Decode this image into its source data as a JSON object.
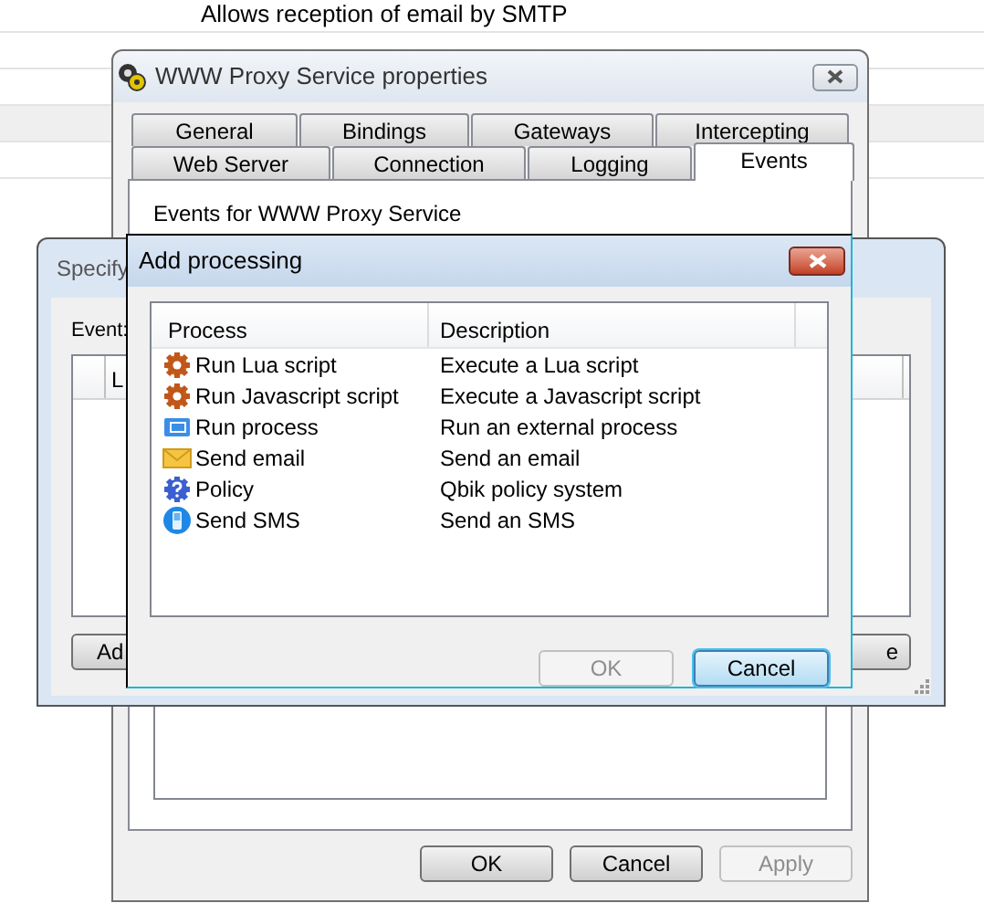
{
  "background_list": {
    "rows": [
      {
        "description": "Allows reception of email by SMTP",
        "selected": false
      },
      {
        "selected": false
      },
      {
        "selected": false
      },
      {
        "selected": true
      },
      {
        "selected": false
      }
    ]
  },
  "properties_window": {
    "title": "WWW Proxy Service properties",
    "tab_rows": [
      [
        {
          "label": "General",
          "selected": false
        },
        {
          "label": "Bindings",
          "selected": false
        },
        {
          "label": "Gateways",
          "selected": false
        },
        {
          "label": "Intercepting",
          "selected": false
        }
      ],
      [
        {
          "label": "Web Server",
          "selected": false
        },
        {
          "label": "Connection",
          "selected": false
        },
        {
          "label": "Logging",
          "selected": false
        },
        {
          "label": "Events",
          "selected": true
        }
      ]
    ],
    "heading": "Events for WWW Proxy Service",
    "buttons": [
      {
        "label": "OK",
        "disabled": false
      },
      {
        "label": "Cancel",
        "disabled": false
      },
      {
        "label": "Apply",
        "disabled": true
      }
    ]
  },
  "specify_window": {
    "title": "Specify",
    "event_label": "Event:",
    "list_column": "L",
    "buttons": [
      {
        "label": "Ad"
      },
      {
        "label": "e"
      }
    ]
  },
  "add_processing_dialog": {
    "title": "Add processing",
    "columns": [
      "Process",
      "Description"
    ],
    "rows": [
      {
        "kind": "gear",
        "process": "Run Lua script",
        "description": "Execute a Lua script"
      },
      {
        "kind": "gear",
        "process": "Run Javascript script",
        "description": "Execute a Javascript script"
      },
      {
        "kind": "process",
        "process": "Run process",
        "description": "Run an external process"
      },
      {
        "kind": "email",
        "process": "Send email",
        "description": "Send an email"
      },
      {
        "kind": "policy",
        "process": "Policy",
        "description": "Qbik policy system"
      },
      {
        "kind": "sms",
        "process": "Send SMS",
        "description": "Send an SMS"
      }
    ],
    "buttons": [
      {
        "label": "OK",
        "disabled": true,
        "default": false
      },
      {
        "label": "Cancel",
        "disabled": false,
        "default": true
      }
    ]
  }
}
